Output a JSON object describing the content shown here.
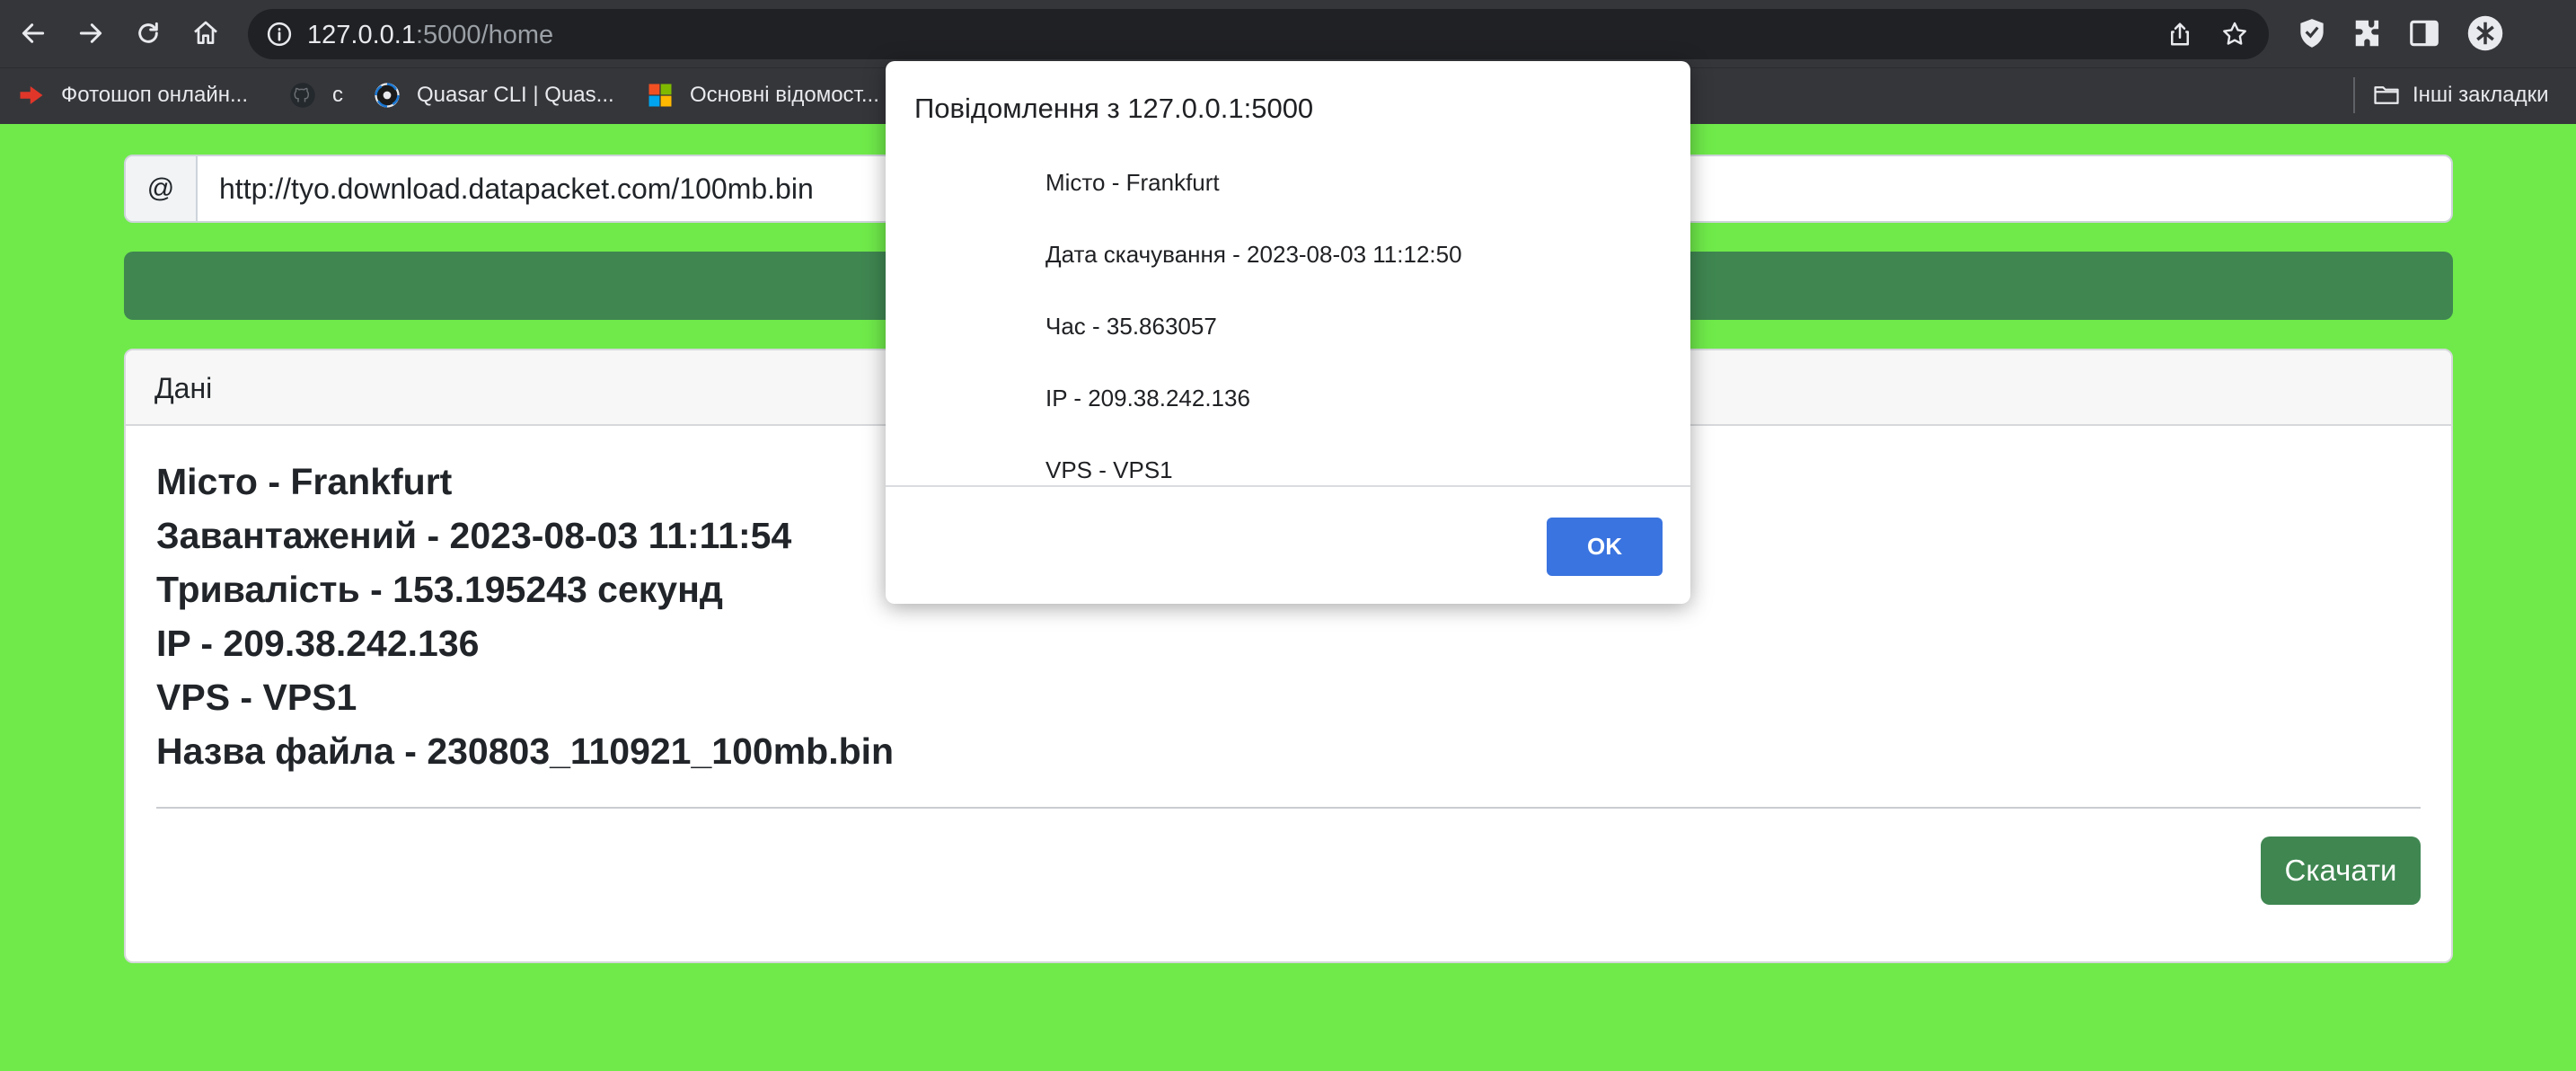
{
  "browser": {
    "url_host": "127.0.0.1",
    "url_path": ":5000/home",
    "bookmarks": [
      {
        "label": "Фотошоп онлайн...",
        "icon": "photoshop-icon"
      },
      {
        "label": "c",
        "icon": "github-icon"
      },
      {
        "label": "Quasar CLI | Quas...",
        "icon": "quasar-icon"
      },
      {
        "label": "Основні відомост...",
        "icon": "microsoft-icon"
      }
    ],
    "other_bookmarks": "Інші закладки"
  },
  "form": {
    "prefix": "@",
    "url_value": "http://tyo.download.datapacket.com/100mb.bin"
  },
  "progress": {
    "value": 100,
    "color": "#3f8651"
  },
  "card": {
    "header": "Дані",
    "lines": [
      "Місто - Frankfurt",
      "Завантажений - 2023-08-03 11:11:54",
      "Тривалість - 153.195243 секунд",
      "IP - 209.38.242.136",
      "VPS - VPS1",
      "Назва файла - 230803_110921_100mb.bin"
    ],
    "download_label": "Скачати"
  },
  "dialog": {
    "title": "Повідомлення з 127.0.0.1:5000",
    "lines": [
      "Місто - Frankfurt",
      "Дата скачування - 2023-08-03 11:12:50",
      "Час - 35.863057",
      "IP - 209.38.242.136",
      "VPS - VPS1"
    ],
    "ok_label": "OK"
  },
  "colors": {
    "page_background": "#6fea4a",
    "accent_green": "#3f8651",
    "ok_blue": "#3a74e0"
  }
}
